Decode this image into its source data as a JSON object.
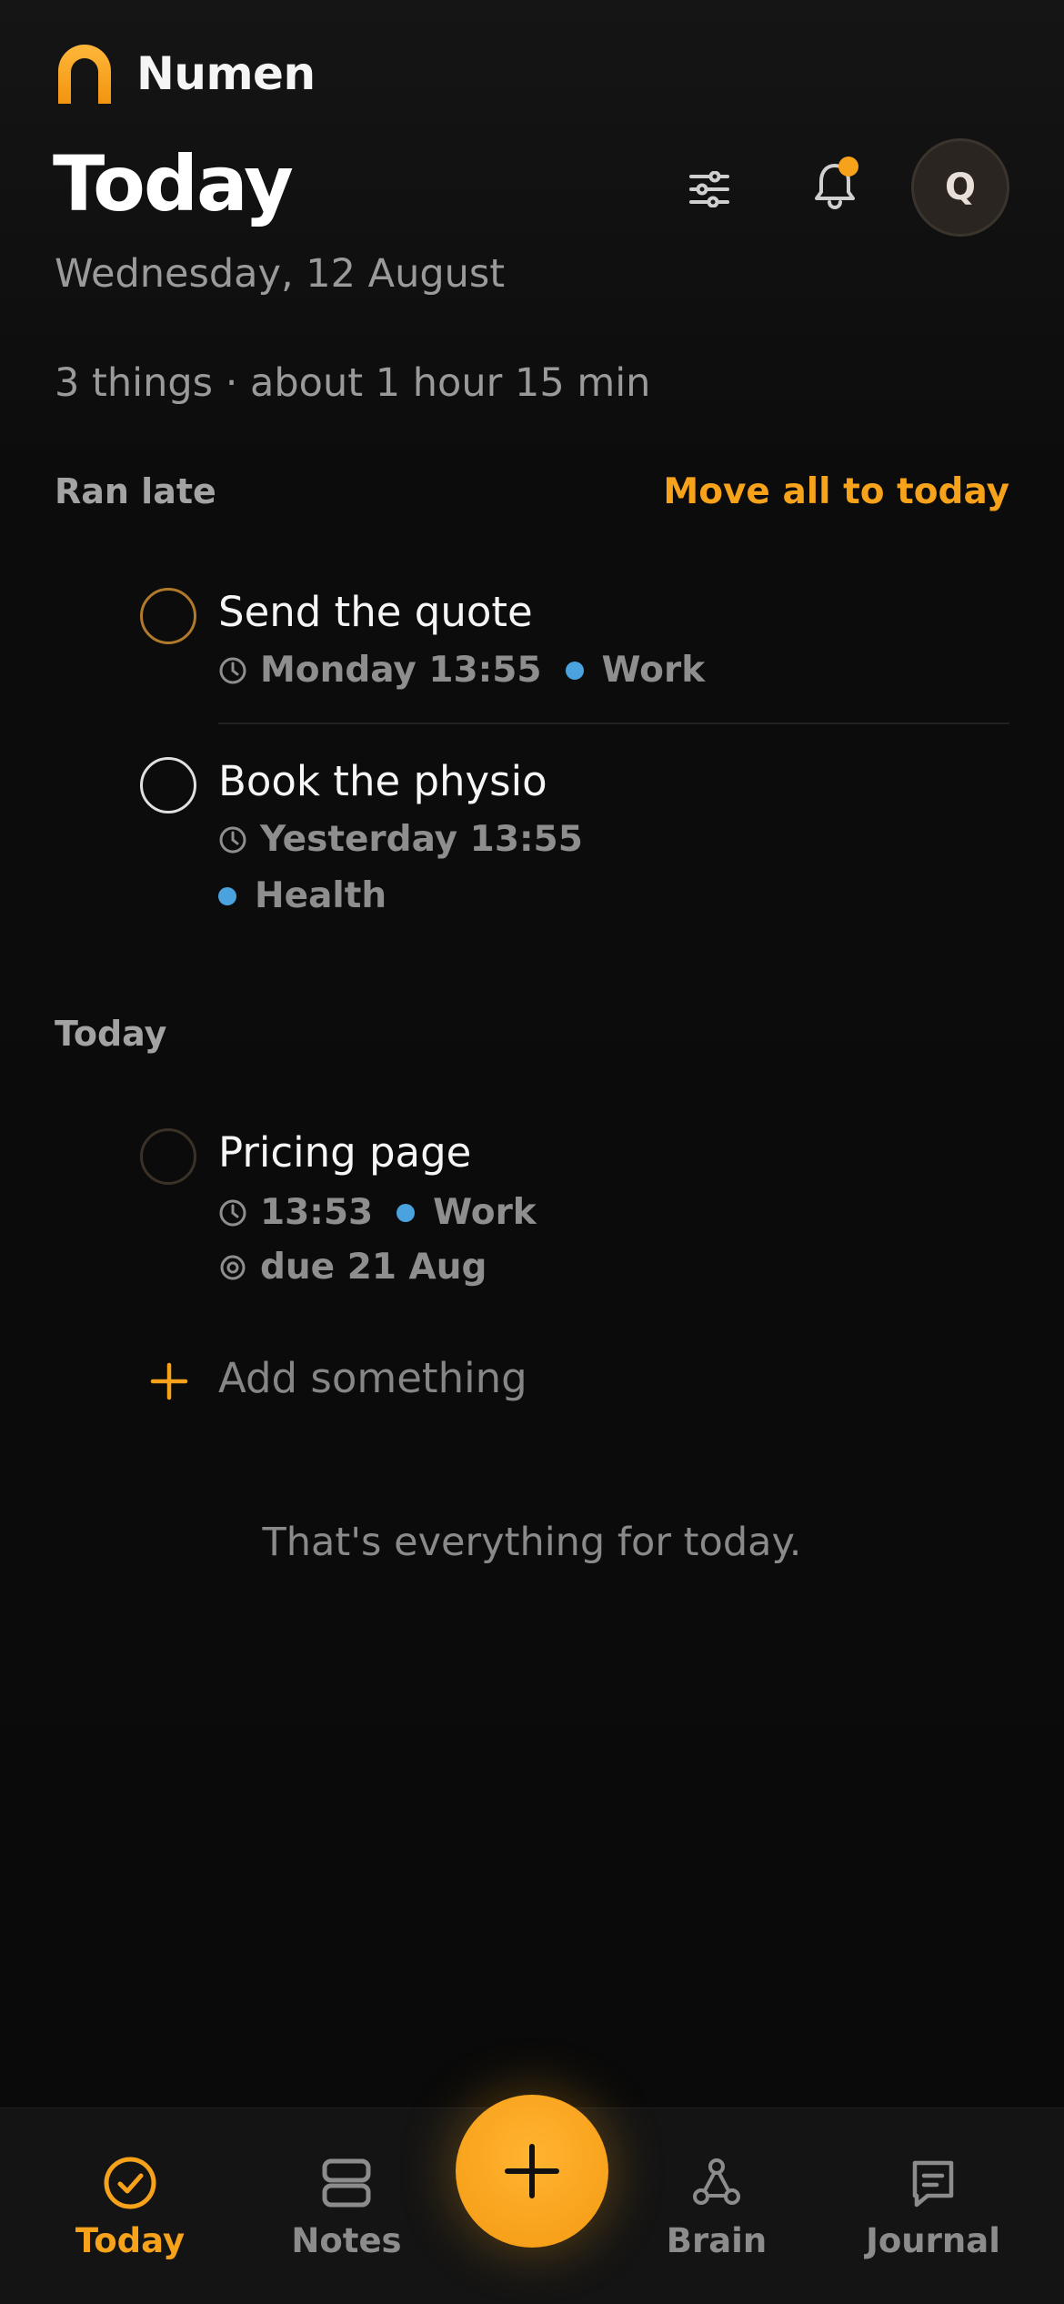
{
  "brand": {
    "name": "Numen",
    "accent": "#f7a21b"
  },
  "header": {
    "title": "Today",
    "date": "Wednesday, 12 August",
    "summary": "3 things · about 1 hour 15 min",
    "filter_icon": "sliders-icon",
    "bell_icon": "bell-icon",
    "avatar_initial": "Q"
  },
  "sections": {
    "ran_late": {
      "label": "Ran late",
      "action": "Move all to today",
      "tasks": [
        {
          "title": "Send the quote",
          "time": "Monday 13:55",
          "tag": "Work",
          "tag_color": "#4aa3df",
          "check_color": "#b07a2a"
        },
        {
          "title": "Book the physio",
          "time": "Yesterday 13:55",
          "tag": "Health",
          "tag_color": "#4aa3df",
          "check_color": "#e0e0e0"
        }
      ]
    },
    "today": {
      "label": "Today",
      "tasks": [
        {
          "title": "Pricing page",
          "time": "13:53",
          "tag": "Work",
          "tag_color": "#4aa3df",
          "due": "due 21 Aug",
          "check_color": "#3a3226"
        }
      ]
    }
  },
  "add": {
    "label": "Add something"
  },
  "empty_message": "That's everything for today.",
  "bottom_nav": {
    "items": [
      {
        "label": "Today",
        "icon": "check-circle-icon",
        "active": true
      },
      {
        "label": "Notes",
        "icon": "notes-icon",
        "active": false
      },
      {
        "label": "Brain",
        "icon": "graph-icon",
        "active": false
      },
      {
        "label": "Journal",
        "icon": "journal-icon",
        "active": false
      }
    ],
    "fab_icon": "plus-icon"
  }
}
